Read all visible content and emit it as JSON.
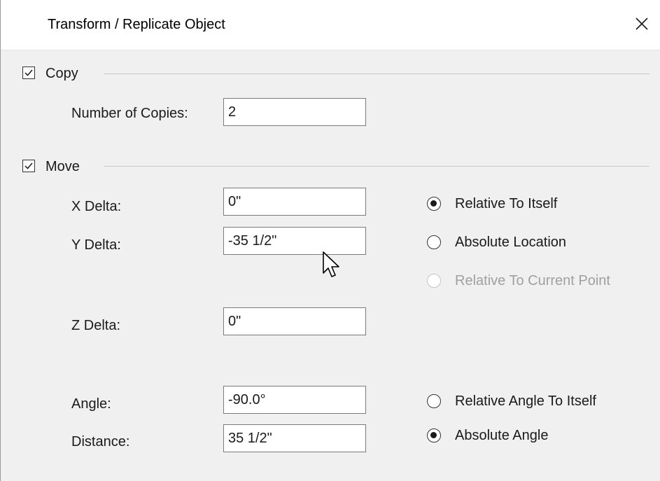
{
  "window": {
    "title": "Transform / Replicate Object",
    "close_icon": "close-icon"
  },
  "copy": {
    "section_label": "Copy",
    "checked": true,
    "number_of_copies_label": "Number of Copies:",
    "number_of_copies_value": "2"
  },
  "move": {
    "section_label": "Move",
    "checked": true,
    "x_delta_label": "X Delta:",
    "x_delta_value": "0\"",
    "y_delta_label": "Y Delta:",
    "y_delta_value": "-35 1/2\"",
    "z_delta_label": "Z Delta:",
    "z_delta_value": "0\"",
    "angle_label": "Angle:",
    "angle_value": "-90.0°",
    "distance_label": "Distance:",
    "distance_value": "35 1/2\"",
    "location_options": [
      {
        "label": "Relative To Itself",
        "selected": true,
        "enabled": true
      },
      {
        "label": "Absolute Location",
        "selected": false,
        "enabled": true
      },
      {
        "label": "Relative To Current Point",
        "selected": false,
        "enabled": false
      }
    ],
    "angle_options": [
      {
        "label": "Relative Angle To Itself",
        "selected": false,
        "enabled": true
      },
      {
        "label": "Absolute Angle",
        "selected": true,
        "enabled": true
      }
    ]
  },
  "colors": {
    "dialog_bg": "#f0f0f0",
    "titlebar_bg": "#ffffff",
    "disabled_text": "#a0a0a0"
  }
}
